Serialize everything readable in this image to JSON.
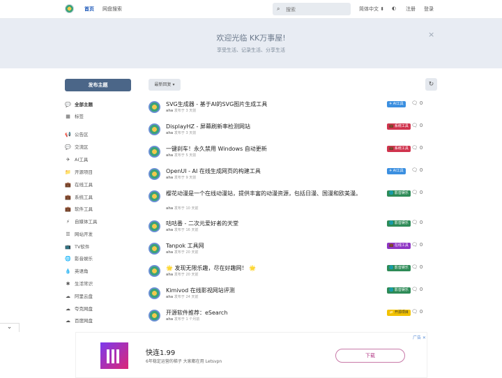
{
  "header": {
    "nav": [
      "首页",
      "网盘搜索"
    ],
    "search_placeholder": "搜索",
    "language": "简体中文 ⬍",
    "theme_icon": "◐",
    "register": "注册",
    "login": "登录"
  },
  "hero": {
    "title": "欢迎光临 KK万事屋!",
    "subtitle": "享受生活、记录生活、分享生活",
    "close": "×"
  },
  "toolbar": {
    "post_button": "发布主题",
    "sort_button": "最新回复 ▾",
    "refresh_icon": "↻"
  },
  "sidebar": {
    "items": [
      {
        "icon": "💬",
        "label": "全部主题",
        "icon_name": "chat-bubbles-icon"
      },
      {
        "icon": "▦",
        "label": "标签",
        "icon_name": "grid-icon"
      },
      {
        "icon": "📢",
        "label": "公告区",
        "icon_name": "megaphone-icon"
      },
      {
        "icon": "💬",
        "label": "交流区",
        "icon_name": "chat-icon"
      },
      {
        "icon": "✈",
        "label": "AI工具",
        "icon_name": "plane-icon"
      },
      {
        "icon": "📁",
        "label": "开源项目",
        "icon_name": "folder-icon"
      },
      {
        "icon": "💼",
        "label": "在线工具",
        "icon_name": "briefcase-icon"
      },
      {
        "icon": "💼",
        "label": "系统工具",
        "icon_name": "briefcase-icon"
      },
      {
        "icon": "💼",
        "label": "软件工具",
        "icon_name": "briefcase-icon"
      },
      {
        "icon": "⚡",
        "label": "自媒体工具",
        "icon_name": "bolt-icon"
      },
      {
        "icon": "☰",
        "label": "网站开发",
        "icon_name": "list-icon"
      },
      {
        "icon": "📺",
        "label": "TV软件",
        "icon_name": "tv-icon"
      },
      {
        "icon": "🌐",
        "label": "影音娱乐",
        "icon_name": "globe-icon"
      },
      {
        "icon": "💧",
        "label": "英语角",
        "icon_name": "drop-icon"
      },
      {
        "icon": "✱",
        "label": "生活常识",
        "icon_name": "asterisk-icon"
      },
      {
        "icon": "☁",
        "label": "阿里云盘",
        "icon_name": "cloud-icon"
      },
      {
        "icon": "☁",
        "label": "夸克网盘",
        "icon_name": "cloud-icon"
      },
      {
        "icon": "☁",
        "label": "百度网盘",
        "icon_name": "cloud-icon"
      }
    ]
  },
  "discussions": [
    {
      "title": "SVG生成器 - 基于AI的SVG图片生成工具",
      "author": "aha",
      "time": "发布于 3 天前",
      "tag": "✈ AI工具",
      "tag_color": "#3b8fe0",
      "replies": "0"
    },
    {
      "title": "DisplayHZ - 屏幕刷新率检测网站",
      "author": "aha",
      "time": "发布于 3 天前",
      "tag": "💼 系统工具",
      "tag_color": "#d0344e",
      "replies": "0"
    },
    {
      "title": "一键刹车！永久禁用 Windows 自动更新",
      "author": "aha",
      "time": "发布于 5 天前",
      "tag": "💼 系统工具",
      "tag_color": "#d0344e",
      "replies": "0"
    },
    {
      "title": "OpenUI - AI 在线生成网页的构建工具",
      "author": "aha",
      "time": "发布于 9 天前",
      "tag": "✈ AI工具",
      "tag_color": "#3b8fe0",
      "replies": "0"
    },
    {
      "title": "樱花动漫是一个在线动漫站，提供丰富的动漫资源，包括日漫、国漫和欧美漫。",
      "author": "aha",
      "time": "发布于 10 天前",
      "tag": "🌐 影音娱乐",
      "tag_color": "#2e8b57",
      "replies": "0"
    },
    {
      "title": "咕咕番 - 二次元爱好者的天堂",
      "author": "aha",
      "time": "发布于 16 天前",
      "tag": "🌐 影音娱乐",
      "tag_color": "#2e8b57",
      "replies": "0"
    },
    {
      "title": "Tanpok 工具网",
      "author": "aha",
      "time": "发布于 20 天前",
      "tag": "💼 在线工具",
      "tag_color": "#8e35c4",
      "replies": "0"
    },
    {
      "title": "🌟 发现无限乐趣，尽在好趣网！ 🌟",
      "author": "aha",
      "time": "发布于 20 天前",
      "tag": "🌐 影音娱乐",
      "tag_color": "#2e8b57",
      "replies": "0"
    },
    {
      "title": "Kimivod 在线影视网站评测",
      "author": "aha",
      "time": "发布于 24 天前",
      "tag": "🌐 影音娱乐",
      "tag_color": "#2e8b57",
      "replies": "0"
    },
    {
      "title": "开源软件推荐：eSearch",
      "author": "aha",
      "time": "发布于 1 个月前",
      "tag": "📁 开源项目",
      "tag_color": "#f2c200",
      "replies": "0"
    }
  ],
  "ad": {
    "title": "快连1.99",
    "subtitle": "6年稳定运营的梯子 大家都在用 Letsvpn",
    "button": "下载",
    "flag": "广告 ✕"
  },
  "collapse_icon": "⌄"
}
